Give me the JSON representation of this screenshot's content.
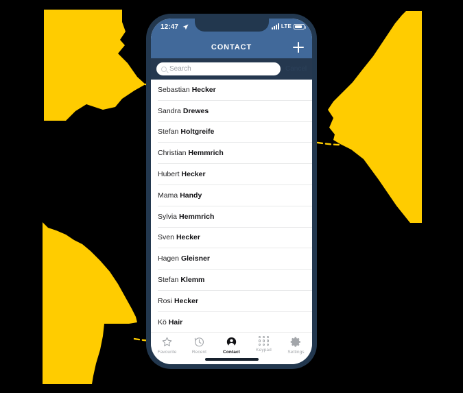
{
  "theme": {
    "page_background": "#000000",
    "accent_yellow": "#FFCC00",
    "phone_frame": "#22374E",
    "header_blue": "#41699A",
    "search_strip": "#25384F",
    "list_background": "#FFFFFF",
    "divider": "#E8E9EA",
    "inactive_tab": "#A3A6AA",
    "active_tab": "#111114"
  },
  "status_bar": {
    "time": "12:47",
    "location_icon": "location-arrow-icon",
    "signal_icon": "signal-bars-icon",
    "network": "LTE",
    "battery_icon": "battery-icon"
  },
  "nav_bar": {
    "title": "CONTACT",
    "add_icon": "plus-icon"
  },
  "search": {
    "icon": "search-icon",
    "value": "",
    "placeholder": "Search",
    "cancel_label": "Cancel"
  },
  "contacts": [
    {
      "first": "Sebastian",
      "last": "Hecker"
    },
    {
      "first": "Sandra",
      "last": "Drewes"
    },
    {
      "first": "Stefan",
      "last": "Holtgreife"
    },
    {
      "first": "Christian",
      "last": "Hemmrich"
    },
    {
      "first": "Hubert",
      "last": "Hecker"
    },
    {
      "first": "Mama",
      "last": "Handy"
    },
    {
      "first": "Sylvia",
      "last": "Hemmrich"
    },
    {
      "first": "Sven",
      "last": "Hecker"
    },
    {
      "first": "Hagen",
      "last": "Gleisner"
    },
    {
      "first": "Stefan",
      "last": "Klemm"
    },
    {
      "first": "Rosi",
      "last": "Hecker"
    },
    {
      "first": "Kö",
      "last": "Hair"
    }
  ],
  "tab_bar": {
    "items": [
      {
        "label": "Favourite",
        "icon": "star-icon",
        "active": false
      },
      {
        "label": "Recent",
        "icon": "clock-icon",
        "active": false
      },
      {
        "label": "Contact",
        "icon": "person-icon",
        "active": true
      },
      {
        "label": "Keypad",
        "icon": "keypad-dots-icon",
        "active": false
      },
      {
        "label": "Settings",
        "icon": "gear-icon",
        "active": false
      }
    ]
  }
}
